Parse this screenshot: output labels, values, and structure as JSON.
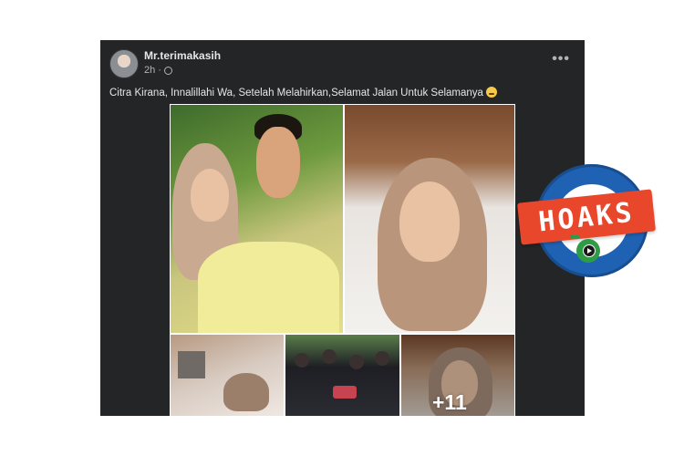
{
  "post": {
    "author": "Mr.terimakasih",
    "time": "2h",
    "more_label": "•••",
    "caption": "Citra Kirana, Innalillahi Wa, Setelah Melahirkan,Selamat Jalan Untuk Selamanya",
    "extra_photos_label": "+11"
  },
  "icons": {
    "privacy": "globe-icon",
    "menu": "more-options-icon",
    "caption_emoji": "crying-face-emoji-icon"
  },
  "badge": {
    "label": "HOAKS",
    "colors": {
      "ring": "#1f62b3",
      "banner": "#e8472c",
      "logo": "#2e9c45"
    }
  },
  "colors": {
    "post_bg": "#242526",
    "text_primary": "#e4e6eb",
    "text_secondary": "#b0b3b8"
  }
}
